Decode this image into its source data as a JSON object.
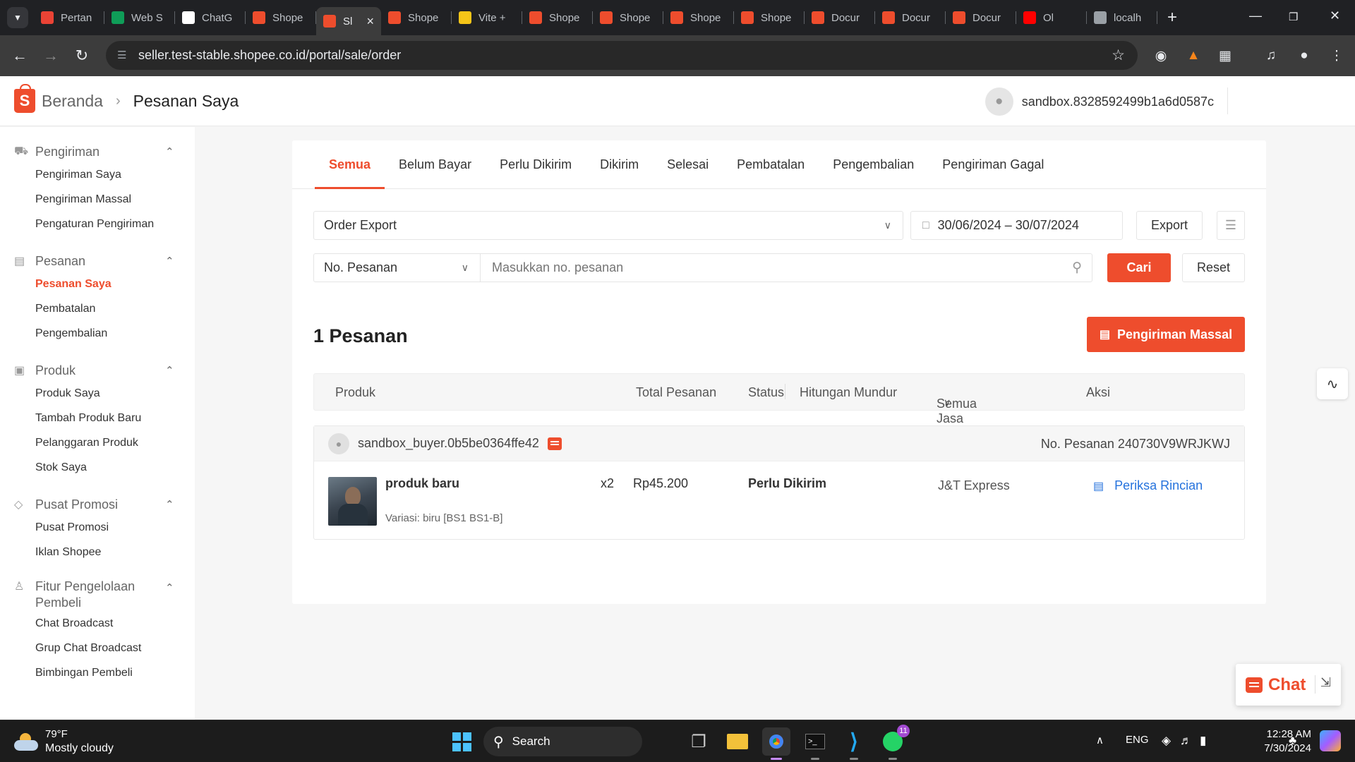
{
  "browser": {
    "tabs": [
      {
        "label": "Pertan",
        "favicon": "gmail-icon",
        "color": "#ea4335"
      },
      {
        "label": "Web S",
        "favicon": "plus-icon",
        "color": "#0f9d58"
      },
      {
        "label": "ChatG",
        "favicon": "chatgpt-icon",
        "color": "#ffffff"
      },
      {
        "label": "Shope",
        "favicon": "shopee-icon",
        "color": "#ee4d2d"
      },
      {
        "label": "Sl",
        "favicon": "shopee-icon",
        "color": "#ee4d2d",
        "active": true
      },
      {
        "label": "Shope",
        "favicon": "shopee-icon",
        "color": "#ee4d2d"
      },
      {
        "label": "Vite +",
        "favicon": "vite-icon",
        "color": "#f5c518"
      },
      {
        "label": "Shope",
        "favicon": "shopee-icon",
        "color": "#ee4d2d"
      },
      {
        "label": "Shope",
        "favicon": "shopee-icon",
        "color": "#ee4d2d"
      },
      {
        "label": "Shope",
        "favicon": "shopee-icon",
        "color": "#ee4d2d"
      },
      {
        "label": "Shope",
        "favicon": "shopee-icon",
        "color": "#ee4d2d"
      },
      {
        "label": "Docur",
        "favicon": "shopee-icon",
        "color": "#ee4d2d"
      },
      {
        "label": "Docur",
        "favicon": "shopee-icon",
        "color": "#ee4d2d"
      },
      {
        "label": "Docur",
        "favicon": "shopee-icon",
        "color": "#ee4d2d"
      },
      {
        "label": "Ol",
        "favicon": "youtube-icon",
        "color": "#ff0000"
      },
      {
        "label": "localh",
        "favicon": "globe-icon",
        "color": "#9aa0a6"
      }
    ],
    "url": "seller.test-stable.shopee.co.id/portal/sale/order"
  },
  "header": {
    "home": "Beranda",
    "current": "Pesanan Saya",
    "username": "sandbox.8328592499b1a6d0587c"
  },
  "sidebar": {
    "sections": [
      {
        "title": "Pengiriman",
        "icon": "truck-icon",
        "items": [
          {
            "label": "Pengiriman Saya"
          },
          {
            "label": "Pengiriman Massal"
          },
          {
            "label": "Pengaturan Pengiriman"
          }
        ]
      },
      {
        "title": "Pesanan",
        "icon": "clipboard-icon",
        "items": [
          {
            "label": "Pesanan Saya",
            "active": true
          },
          {
            "label": "Pembatalan"
          },
          {
            "label": "Pengembalian"
          }
        ]
      },
      {
        "title": "Produk",
        "icon": "box-icon",
        "items": [
          {
            "label": "Produk Saya"
          },
          {
            "label": "Tambah Produk Baru"
          },
          {
            "label": "Pelanggaran Produk"
          },
          {
            "label": "Stok Saya"
          }
        ]
      },
      {
        "title": "Pusat Promosi",
        "icon": "tag-icon",
        "items": [
          {
            "label": "Pusat Promosi"
          },
          {
            "label": "Iklan Shopee"
          }
        ]
      },
      {
        "title": "Fitur Pengelolaan Pembeli",
        "icon": "people-icon",
        "twoline": true,
        "items": [
          {
            "label": "Chat Broadcast"
          },
          {
            "label": "Grup Chat Broadcast"
          },
          {
            "label": "Bimbingan Pembeli"
          }
        ]
      }
    ]
  },
  "order_tabs": [
    "Semua",
    "Belum Bayar",
    "Perlu Dikirim",
    "Dikirim",
    "Selesai",
    "Pembatalan",
    "Pengembalian",
    "Pengiriman Gagal"
  ],
  "filters": {
    "export_type": "Order Export",
    "date_range": "30/06/2024 – 30/07/2024",
    "export_label": "Export",
    "search_type": "No. Pesanan",
    "search_placeholder": "Masukkan no. pesanan",
    "search_value": "",
    "cari_label": "Cari",
    "reset_label": "Reset"
  },
  "summary": {
    "count_text": "1 Pesanan",
    "bulk_label": "Pengiriman Massal"
  },
  "table": {
    "columns": {
      "produk": "Produk",
      "total": "Total Pesanan",
      "status": "Status",
      "countdown": "Hitungan Mundur",
      "courier_filter": "Semua Jasa Kirim",
      "aksi": "Aksi"
    }
  },
  "order": {
    "buyer": "sandbox_buyer.0b5be0364ffe42",
    "order_no": "No. Pesanan 240730V9WRJKWJ",
    "product_name": "produk baru",
    "variant": "Variasi: biru [BS1 BS1-B]",
    "qty": "x2",
    "price": "Rp45.200",
    "status": "Perlu Dikirim",
    "courier": "J&T Express",
    "action": "Periksa Rincian"
  },
  "chat_widget": {
    "label": "Chat"
  },
  "taskbar": {
    "weather_temp": "79°F",
    "weather_desc": "Mostly cloudy",
    "search": "Search",
    "lang": "ENG",
    "time": "12:28 AM",
    "date": "7/30/2024",
    "whatsapp_badge": "11"
  },
  "colors": {
    "brand": "#ee4d2d",
    "link": "#2673dd"
  }
}
